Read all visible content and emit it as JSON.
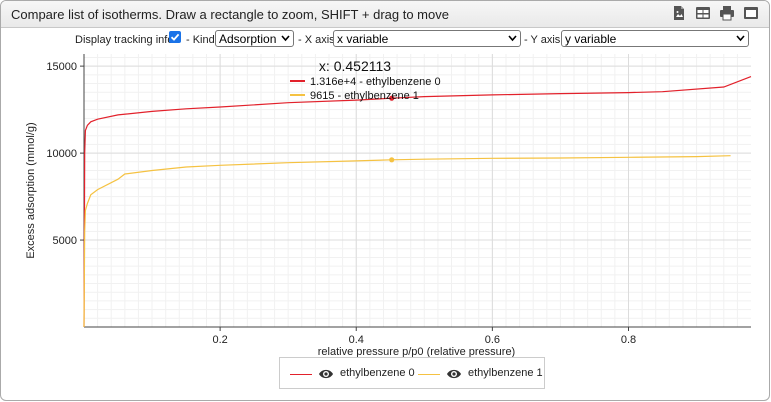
{
  "header": {
    "title": "Compare list of isotherms. Draw a rectangle to zoom, SHIFT + drag to move",
    "icons": [
      "export-image-icon",
      "table-icon",
      "print-icon",
      "fullscreen-icon"
    ]
  },
  "controls": {
    "tracking_label": "Display tracking info:",
    "tracking_checked": true,
    "kind_label": "- Kind:",
    "kind_value": "Adsorption",
    "xaxis_label": "- X axis:",
    "xaxis_value": "x variable",
    "yaxis_label": "- Y axis:",
    "yaxis_value": "y variable"
  },
  "tooltip": {
    "x_text": "x: 0.452113",
    "entries": [
      {
        "text": "1.316e+4 - ethylbenzene 0",
        "color": "#e2212b"
      },
      {
        "text": "9615 - ethylbenzene 1",
        "color": "#f5c242"
      }
    ]
  },
  "legend": [
    {
      "label": "ethylbenzene 0",
      "color": "#e2212b"
    },
    {
      "label": "ethylbenzene 1",
      "color": "#f5c242"
    }
  ],
  "chart_data": {
    "type": "line",
    "xlabel": "relative pressure p/p0  (relative pressure)",
    "ylabel": "Excess adsorption  (mmol/g)",
    "xlim": [
      0.0,
      0.98
    ],
    "ylim": [
      0,
      15700
    ],
    "xticks": [
      0.2,
      0.4,
      0.6,
      0.8
    ],
    "xtick_labels": [
      "0.2",
      "0.4",
      "0.6",
      "0.8"
    ],
    "yticks": [
      5000,
      10000,
      15000
    ],
    "ytick_labels": [
      "5000",
      "10000",
      "15000"
    ],
    "grid": true,
    "tracking_x": 0.452113,
    "series": [
      {
        "name": "ethylbenzene 0",
        "color": "#e2212b",
        "x": [
          0.0,
          0.001,
          0.002,
          0.005,
          0.01,
          0.02,
          0.05,
          0.1,
          0.15,
          0.2,
          0.3,
          0.4,
          0.452113,
          0.5,
          0.6,
          0.7,
          0.8,
          0.85,
          0.94,
          0.98
        ],
        "y": [
          0,
          10000,
          11300,
          11600,
          11800,
          11950,
          12200,
          12400,
          12550,
          12650,
          12900,
          13050,
          13160,
          13250,
          13350,
          13420,
          13480,
          13530,
          13800,
          14400
        ]
      },
      {
        "name": "ethylbenzene 1",
        "color": "#f5c242",
        "x": [
          0.0,
          0.001,
          0.002,
          0.005,
          0.01,
          0.02,
          0.05,
          0.06,
          0.1,
          0.15,
          0.2,
          0.3,
          0.4,
          0.452113,
          0.5,
          0.6,
          0.7,
          0.8,
          0.9,
          0.95
        ],
        "y": [
          0,
          5500,
          6700,
          7100,
          7600,
          7900,
          8500,
          8800,
          9000,
          9200,
          9300,
          9450,
          9550,
          9615,
          9650,
          9700,
          9720,
          9760,
          9800,
          9850
        ]
      }
    ]
  }
}
